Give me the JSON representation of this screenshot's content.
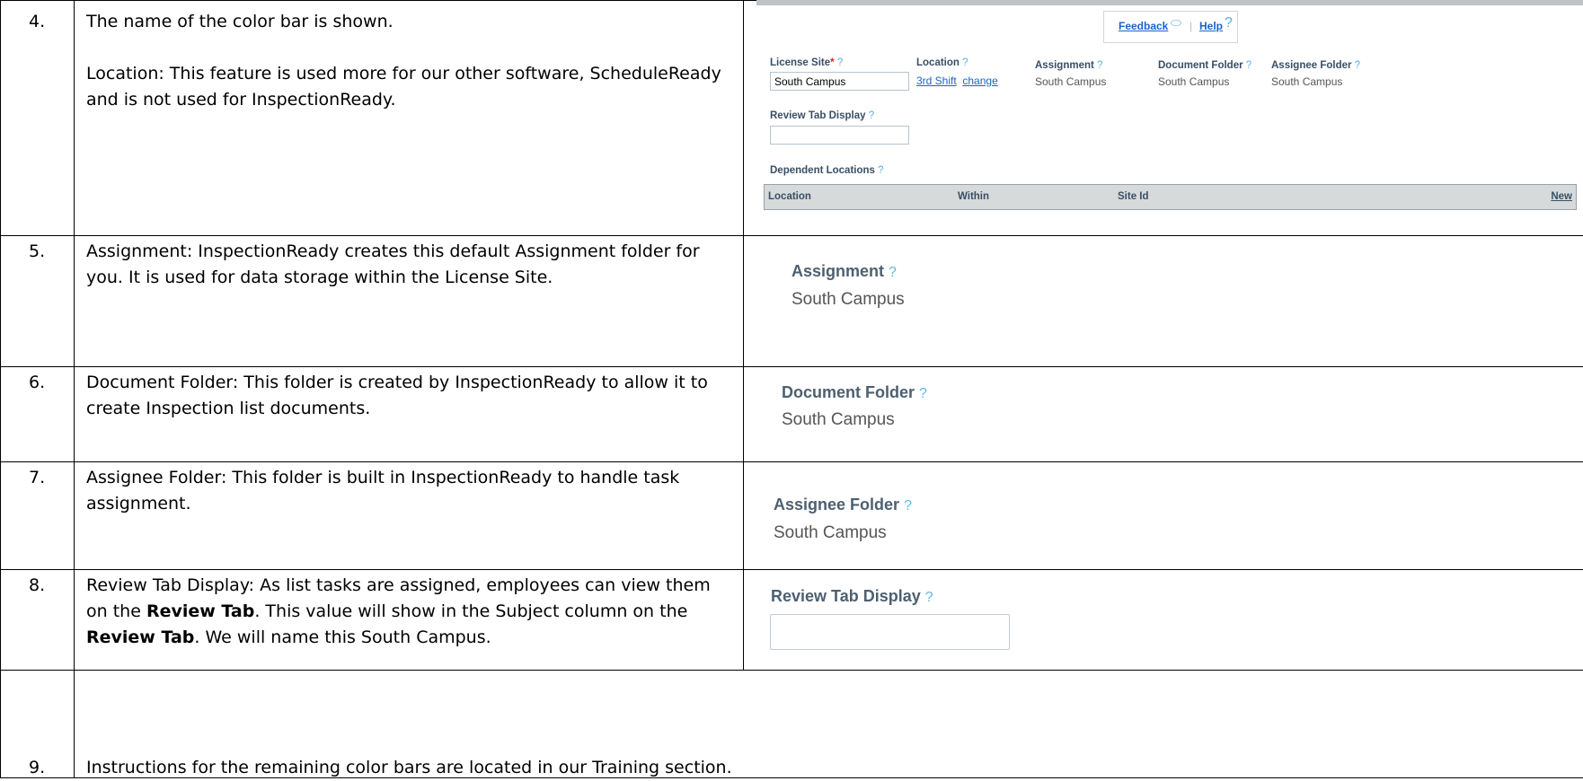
{
  "rows": [
    {
      "num": "4.",
      "lines": [
        "The name of the color bar is shown.",
        "",
        "Location:  This feature is used more for our other software, ScheduleReady and is not used for InspectionReady."
      ]
    },
    {
      "num": "5.",
      "text": "Assignment:  InspectionReady creates this default Assignment folder for you.  It is used for data storage within the License Site."
    },
    {
      "num": "6.",
      "text": "Document Folder:  This folder is created by InspectionReady to allow it to create Inspection list documents."
    },
    {
      "num": "7.",
      "text": "Assignee Folder:  This folder is built in InspectionReady to handle task assignment."
    },
    {
      "num": "8.",
      "parts": [
        "Review Tab Display:  As list tasks are assigned, employees can view them on the ",
        "Review Tab",
        ".  This value will show in the Subject column on the ",
        "Review Tab",
        ".  We will name this South Campus."
      ]
    },
    {
      "num": "9.",
      "text": "Instructions for the remaining color bars are located in our Training section."
    }
  ],
  "panel": {
    "feedback_label": "Feedback",
    "help_label": "Help",
    "separator": "|",
    "license_site_label": "License Site",
    "license_site_value": "South Campus",
    "location_label": "Location",
    "location_value": "3rd Shift",
    "location_change": "change",
    "assignment_label": "Assignment",
    "assignment_value": "South Campus",
    "document_folder_label": "Document Folder",
    "document_folder_value": "South Campus",
    "assignee_folder_label": "Assignee Folder",
    "assignee_folder_value": "South Campus",
    "review_tab_label": "Review Tab Display",
    "review_tab_value": "",
    "dependent_locations_label": "Dependent Locations",
    "grid_cols": [
      "Location",
      "Within",
      "Site Id"
    ],
    "grid_new": "New"
  },
  "closeups": {
    "assignment_label": "Assignment",
    "assignment_value": "South Campus",
    "document_folder_label": "Document Folder",
    "document_folder_value": "South Campus",
    "assignee_folder_label": "Assignee Folder",
    "assignee_folder_value": "South Campus",
    "review_tab_label": "Review Tab Display",
    "review_tab_value": ""
  },
  "help_glyph": "?",
  "required_glyph": "*",
  "colors": {
    "link": "#1c63c8",
    "help": "#5fb0e0",
    "label": "#384f66"
  }
}
